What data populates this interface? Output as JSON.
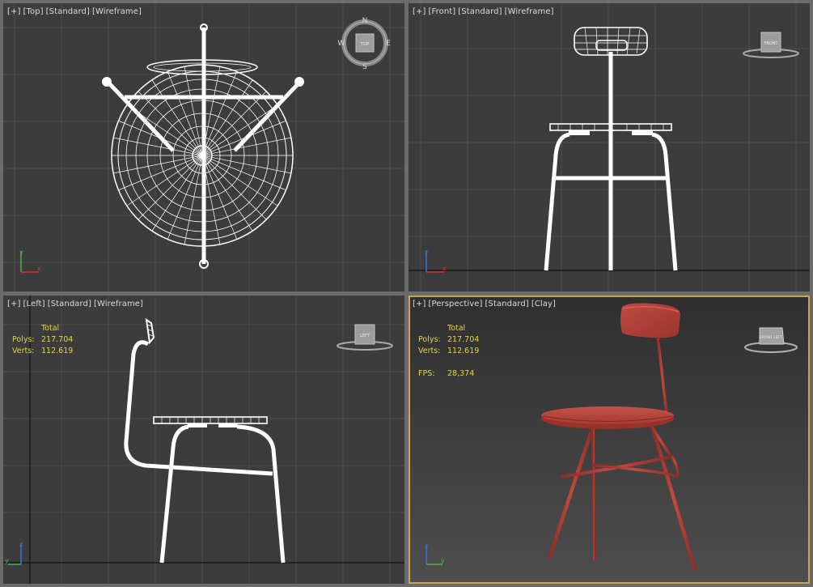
{
  "viewports": {
    "top": {
      "labels": [
        "[+]",
        "[Top]",
        "[Standard]",
        "[Wireframe]"
      ]
    },
    "front": {
      "labels": [
        "[+]",
        "[Front]",
        "[Standard]",
        "[Wireframe]"
      ],
      "cube_label": "FRONT"
    },
    "left": {
      "labels": [
        "[+]",
        "[Left]",
        "[Standard]",
        "[Wireframe]"
      ],
      "cube_label": "LEFT",
      "stats": {
        "header": "Total",
        "polys_label": "Polys:",
        "polys": "217.704",
        "verts_label": "Verts:",
        "verts": "112.619"
      }
    },
    "perspective": {
      "labels": [
        "[+]",
        "[Perspective]",
        "[Standard]",
        "[Clay]"
      ],
      "cube_label": "FRONT LEFT",
      "stats": {
        "header": "Total",
        "polys_label": "Polys:",
        "polys": "217.704",
        "verts_label": "Verts:",
        "verts": "112.619",
        "fps_label": "FPS:",
        "fps": "28,374"
      }
    }
  },
  "compass": {
    "n": "N",
    "s": "S",
    "e": "E",
    "w": "W",
    "cube_label": "TOP"
  },
  "axis_labels": {
    "x": "x",
    "y": "y",
    "z": "z"
  },
  "colors": {
    "active_border": "#c8a64d",
    "stats_text": "#e9d43a",
    "chair_clay": "#b5433a",
    "wireframe": "#ffffff"
  }
}
